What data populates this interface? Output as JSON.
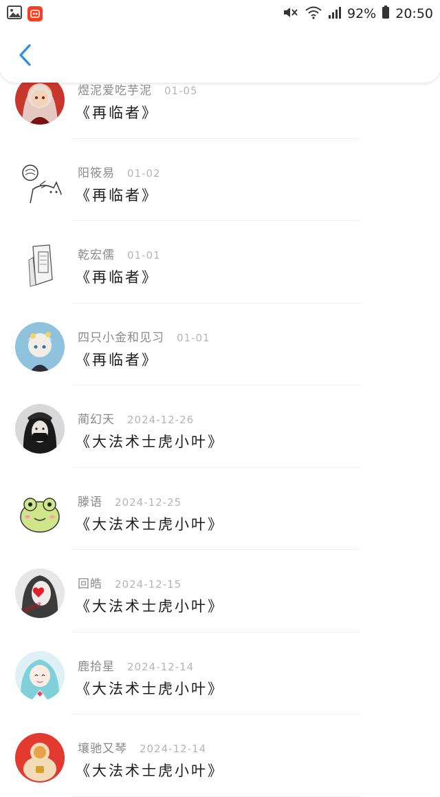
{
  "status_bar": {
    "battery_percent": "92%",
    "time": "20:50",
    "icons": [
      "gallery-icon",
      "app-badge-icon",
      "mute-icon",
      "wifi-icon",
      "signal-icon",
      "battery-icon"
    ]
  },
  "header": {
    "back_icon": "chevron-left-icon",
    "accent_color": "#2a8fe0"
  },
  "list": {
    "items": [
      {
        "name": "煜泥爱吃芋泥",
        "date": "01-05",
        "title": "《再临者》",
        "avatar": "avatar-anime-red"
      },
      {
        "name": "阳筱易",
        "date": "01-02",
        "title": "《再临者》",
        "avatar": "avatar-sketch-cat"
      },
      {
        "name": "乾宏儒",
        "date": "01-01",
        "title": "《再临者》",
        "avatar": "avatar-sketch-phone"
      },
      {
        "name": "四只小金和见习",
        "date": "01-01",
        "title": "《再临者》",
        "avatar": "avatar-anime-blue"
      },
      {
        "name": "蔺幻天",
        "date": "2024-12-26",
        "title": "《大法术士虎小叶》",
        "avatar": "avatar-girl-mask"
      },
      {
        "name": "滕语",
        "date": "2024-12-25",
        "title": "《大法术士虎小叶》",
        "avatar": "avatar-frog"
      },
      {
        "name": "回皓",
        "date": "2024-12-15",
        "title": "《大法术士虎小叶》",
        "avatar": "avatar-girl-heart"
      },
      {
        "name": "鹿拾星",
        "date": "2024-12-14",
        "title": "《大法术士虎小叶》",
        "avatar": "avatar-anime-miku"
      },
      {
        "name": "壤驰又琴",
        "date": "2024-12-14",
        "title": "《大法术士虎小叶》",
        "avatar": "avatar-red-figure"
      }
    ]
  }
}
